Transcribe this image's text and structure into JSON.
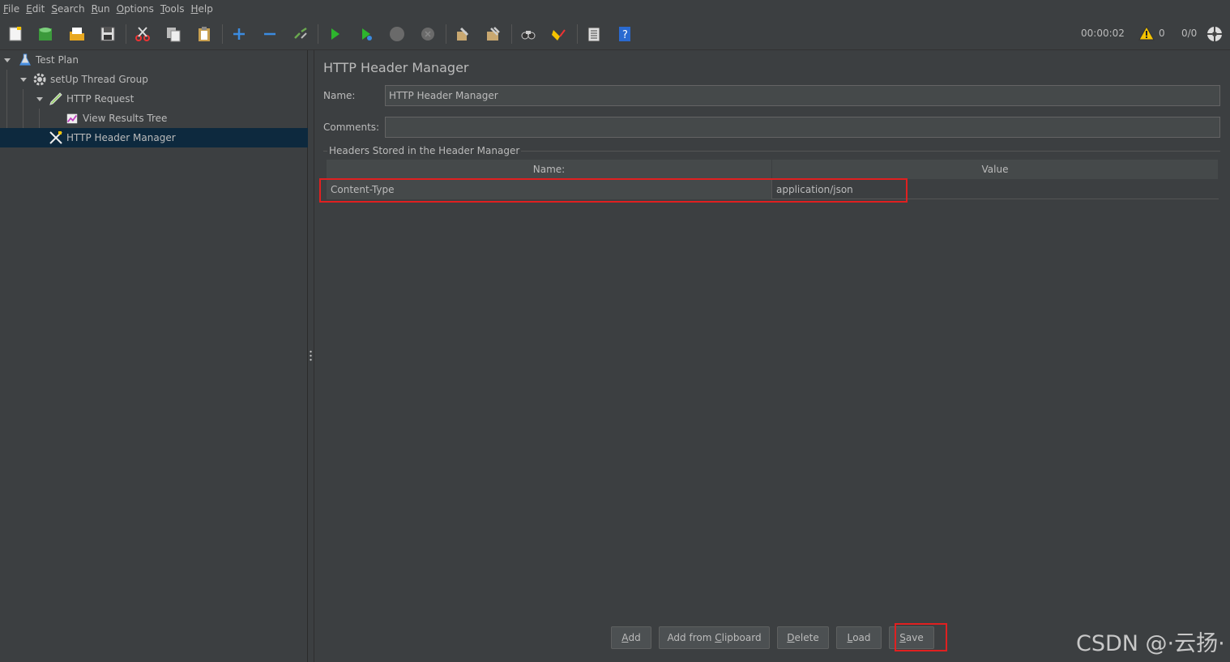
{
  "menu": {
    "items": [
      {
        "first": "F",
        "rest": "ile"
      },
      {
        "first": "E",
        "rest": "dit"
      },
      {
        "first": "S",
        "rest": "earch"
      },
      {
        "first": "R",
        "rest": "un"
      },
      {
        "first": "O",
        "rest": "ptions"
      },
      {
        "first": "T",
        "rest": "ools"
      },
      {
        "first": "H",
        "rest": "elp"
      }
    ]
  },
  "toolbar": {
    "icons": [
      "new-icon",
      "templates-icon",
      "open-icon",
      "save-icon",
      "cut-icon",
      "copy-icon",
      "paste-icon",
      "expand-icon",
      "collapse-icon",
      "toggle-icon",
      "start-icon",
      "start-no-pause-icon",
      "stop-icon",
      "shutdown-icon",
      "clear-icon",
      "clear-all-icon",
      "search-icon",
      "reset-search-icon",
      "function-helper-icon",
      "help-icon"
    ],
    "elapsed_time": "00:00:02",
    "warning_count": "0",
    "active_threads": "0/0",
    "warning_color": "#f5c400"
  },
  "tree": {
    "nodes": [
      {
        "label": "Test Plan",
        "icon": "test-plan-icon"
      },
      {
        "label": "setUp Thread Group",
        "icon": "thread-group-gear-icon"
      },
      {
        "label": "HTTP Request",
        "icon": "http-request-pen-icon"
      },
      {
        "label": "View Results Tree",
        "icon": "results-tree-chart-icon"
      },
      {
        "label": "HTTP Header Manager",
        "icon": "header-manager-tools-icon"
      }
    ],
    "selected_color": "#0d293e"
  },
  "main": {
    "title": "HTTP Header Manager",
    "name_label": "Name:",
    "name_value": "HTTP Header Manager",
    "comments_label": "Comments:",
    "comments_value": "",
    "group_title": "Headers Stored in the Header Manager",
    "table": {
      "columns": [
        "Name:",
        "Value"
      ],
      "rows": [
        {
          "name": "Content-Type",
          "value": "application/json"
        }
      ]
    },
    "buttons": {
      "add": {
        "mn": "A",
        "rest": "dd"
      },
      "add_clipboard": {
        "pre": "Add from ",
        "mn": "C",
        "rest": "lipboard"
      },
      "delete": {
        "mn": "D",
        "rest": "elete"
      },
      "load": {
        "mn": "L",
        "rest": "oad"
      },
      "save": {
        "mn": "S",
        "rest": "ave"
      }
    }
  },
  "highlight_color": "#e02020",
  "watermark": "CSDN @·云扬·"
}
